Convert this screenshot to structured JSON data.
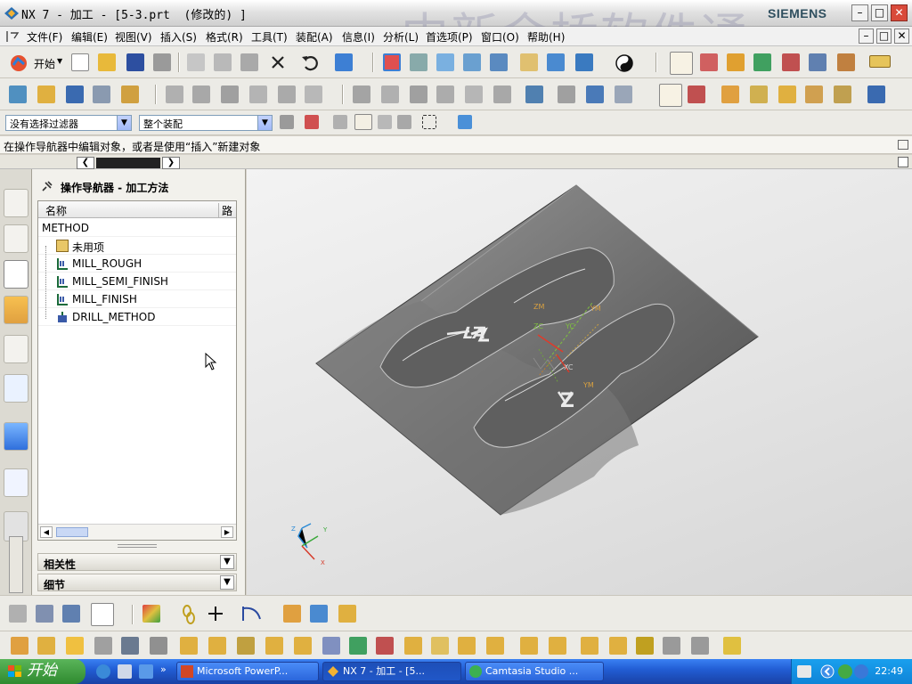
{
  "window": {
    "title": "NX 7 - 加工 - [5-3.prt  (修改的) ]",
    "brand": "SIEMENS",
    "watermark": "中新金桥软件通"
  },
  "menu": {
    "items": [
      "文件(F)",
      "编辑(E)",
      "视图(V)",
      "插入(S)",
      "格式(R)",
      "工具(T)",
      "装配(A)",
      "信息(I)",
      "分析(L)",
      "首选项(P)",
      "窗口(O)",
      "帮助(H)"
    ]
  },
  "toolbar": {
    "start_label": "开始"
  },
  "filters": {
    "selection_filter": "没有选择过滤器",
    "assembly_scope": "整个装配"
  },
  "status": {
    "message": "在操作导航器中编辑对象，或者是使用“插入”新建对象"
  },
  "navigator": {
    "title": "操作导航器 - 加工方法",
    "columns": [
      "名称",
      "路"
    ],
    "root": "METHOD",
    "items": [
      "未用项",
      "MILL_ROUGH",
      "MILL_SEMI_FINISH",
      "MILL_FINISH",
      "DRILL_METHOD"
    ],
    "sections": [
      "相关性",
      "细节"
    ]
  },
  "viewport": {
    "labels": [
      "ZM",
      "YM",
      "ZC",
      "YC",
      "XC",
      "YM"
    ],
    "triad": [
      "Z",
      "Y",
      "X"
    ],
    "engraving": [
      "LA",
      "Z"
    ]
  },
  "taskbar": {
    "start": "开始",
    "tasks": [
      "Microsoft PowerP...",
      "NX 7 - 加工 - [5...",
      "Camtasia Studio ..."
    ],
    "clock": "22:49"
  },
  "colors": {
    "accent": "#316ac5",
    "model": "#6b6b6b",
    "taskbar": "#225ed5",
    "start": "#3c9a3c"
  }
}
